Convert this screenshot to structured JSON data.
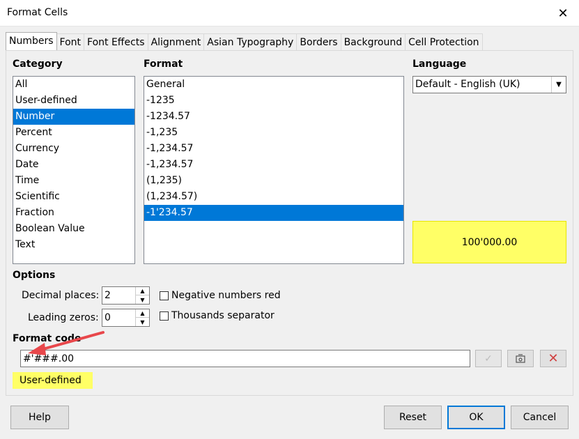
{
  "window": {
    "title": "Format Cells"
  },
  "tabs": [
    "Numbers",
    "Font",
    "Font Effects",
    "Alignment",
    "Asian Typography",
    "Borders",
    "Background",
    "Cell Protection"
  ],
  "category": {
    "label": "Category",
    "items": [
      "All",
      "User-defined",
      "Number",
      "Percent",
      "Currency",
      "Date",
      "Time",
      "Scientific",
      "Fraction",
      "Boolean Value",
      "Text"
    ],
    "selected": "Number"
  },
  "format": {
    "label": "Format",
    "items": [
      "General",
      "-1235",
      "-1234.57",
      "-1,235",
      "-1,234.57",
      "-1,234.57",
      "(1,235)",
      "(1,234.57)",
      "-1'234.57"
    ],
    "selected": "-1'234.57"
  },
  "language": {
    "label": "Language",
    "selected": "Default - English (UK)"
  },
  "preview": {
    "value": "100'000.00"
  },
  "options": {
    "label": "Options",
    "decimal_places_label": "Decimal places:",
    "decimal_places": "2",
    "leading_zeros_label": "Leading zeros:",
    "leading_zeros": "0",
    "negative_red_label": "Negative numbers red",
    "thousands_sep_label": "Thousands separator"
  },
  "format_code": {
    "label": "Format code",
    "value": "#'###.00",
    "status": "User-defined"
  },
  "buttons": {
    "help": "Help",
    "reset": "Reset",
    "ok": "OK",
    "cancel": "Cancel"
  },
  "colors": {
    "highlight": "#ffff66",
    "selection": "#0078d7",
    "annotation_arrow": "#e8474b"
  }
}
